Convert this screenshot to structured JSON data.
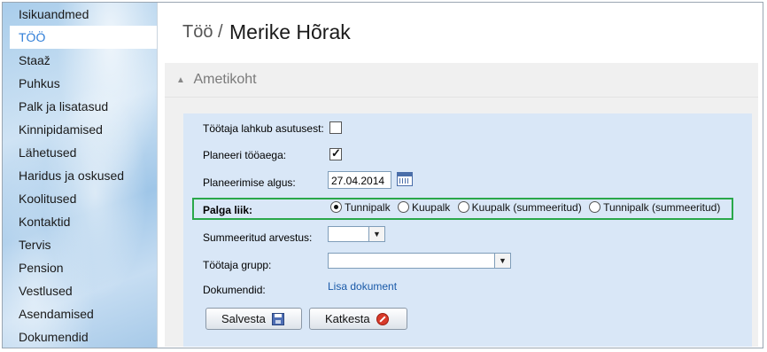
{
  "sidebar": {
    "items": [
      {
        "label": "Isikuandmed",
        "active": false
      },
      {
        "label": "TÖÖ",
        "active": true
      },
      {
        "label": "Staaž",
        "active": false
      },
      {
        "label": "Puhkus",
        "active": false
      },
      {
        "label": "Palk ja lisatasud",
        "active": false
      },
      {
        "label": "Kinnipidamised",
        "active": false
      },
      {
        "label": "Lähetused",
        "active": false
      },
      {
        "label": "Haridus ja oskused",
        "active": false
      },
      {
        "label": "Koolitused",
        "active": false
      },
      {
        "label": "Kontaktid",
        "active": false
      },
      {
        "label": "Tervis",
        "active": false
      },
      {
        "label": "Pension",
        "active": false
      },
      {
        "label": "Vestlused",
        "active": false
      },
      {
        "label": "Asendamised",
        "active": false
      },
      {
        "label": "Dokumendid",
        "active": false
      }
    ]
  },
  "header": {
    "crumb_prefix": "Töö /",
    "person_name": "Merike Hõrak"
  },
  "section": {
    "title": "Ametikoht",
    "toggle_icon": "triangle-up-icon"
  },
  "form": {
    "leaving_label": "Töötaja lahkub asutusest:",
    "leaving_checked": false,
    "plan_label": "Planeeri tööaega:",
    "plan_checked": true,
    "plan_start_label": "Planeerimise algus:",
    "plan_start_value": "27.04.2014",
    "pay_type_label": "Palga liik:",
    "pay_type_options": [
      {
        "label": "Tunnipalk",
        "selected": true
      },
      {
        "label": "Kuupalk",
        "selected": false
      },
      {
        "label": "Kuupalk (summeeritud)",
        "selected": false
      },
      {
        "label": "Tunnipalk (summeeritud)",
        "selected": false
      }
    ],
    "summed_label": "Summeeritud arvestus:",
    "summed_value": "",
    "group_label": "Töötaja grupp:",
    "group_value": "",
    "documents_label": "Dokumendid:",
    "add_document_link": "Lisa dokument"
  },
  "buttons": {
    "save_label": "Salvesta",
    "cancel_label": "Katkesta"
  },
  "colors": {
    "highlight_border": "#2aa84a",
    "active_nav": "#2f7ed8",
    "link": "#1a5aa8",
    "panel": "#d9e7f7"
  }
}
